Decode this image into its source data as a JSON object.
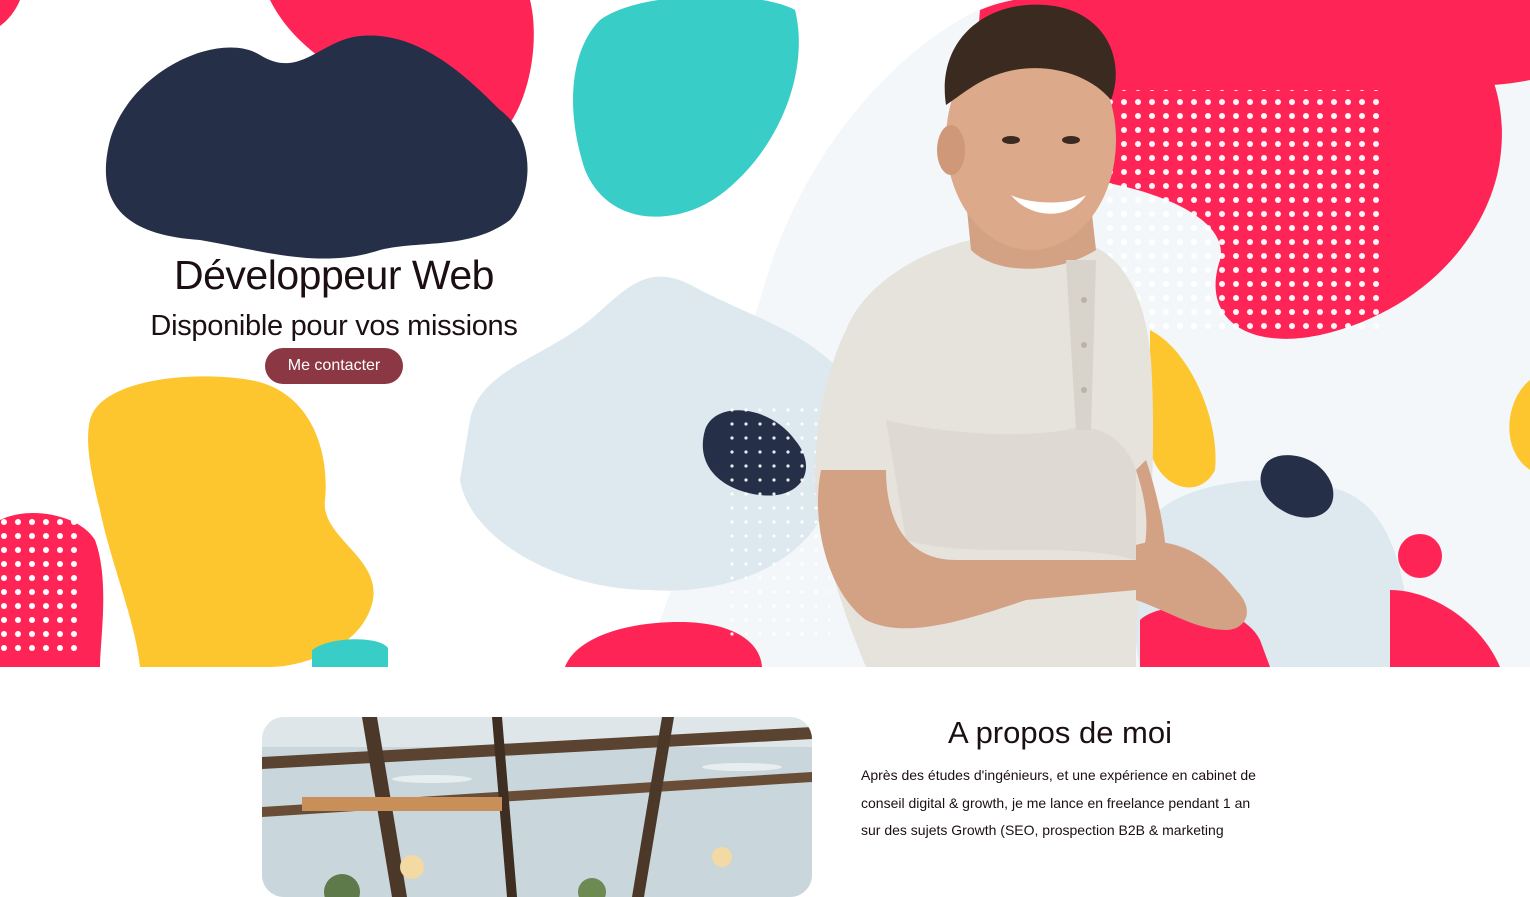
{
  "hero": {
    "title": "Développeur Web",
    "subtitle": "Disponible pour vos missions",
    "cta_label": "Me contacter"
  },
  "about": {
    "title": "A propos de moi",
    "text": "Après des études d'ingénieurs, et une expérience en cabinet de conseil digital & growth, je me lance en freelance pendant 1 an sur des sujets Growth (SEO, prospection B2B & marketing"
  },
  "colors": {
    "navy": "#262f48",
    "teal": "#39cdc8",
    "pink": "#fe2556",
    "yellow": "#fec62e",
    "pale_blue": "#dde8ef",
    "button": "#8b3744"
  }
}
